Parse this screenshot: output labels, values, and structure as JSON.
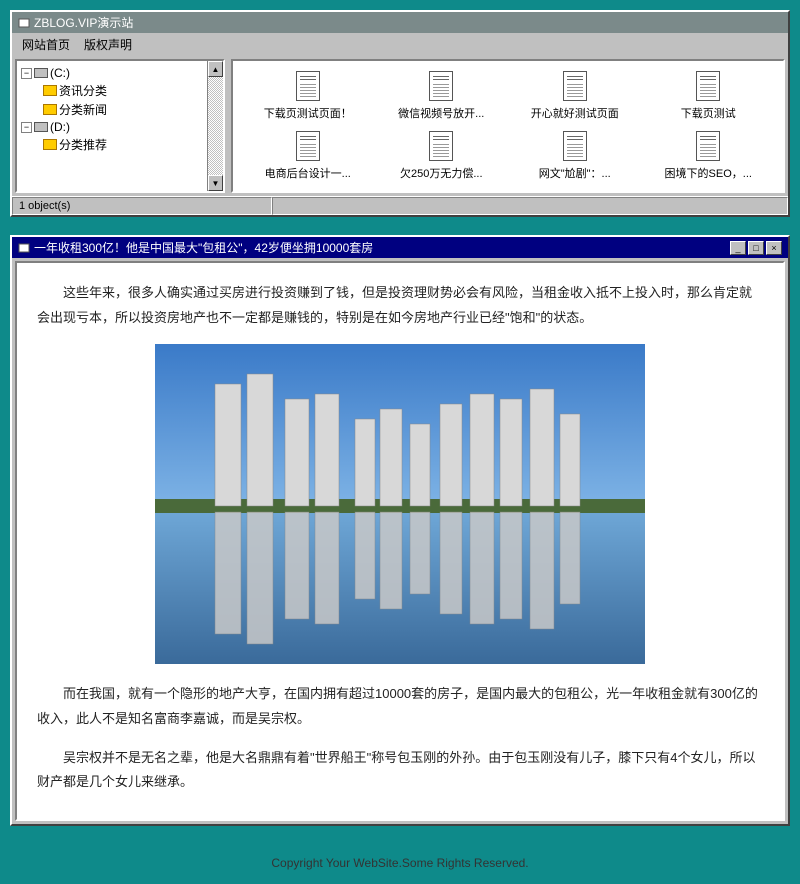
{
  "topWindow": {
    "title": "ZBLOG.VIP演示站",
    "menu": {
      "home": "网站首页",
      "copyright": "版权声明"
    },
    "tree": {
      "driveC": {
        "label": "(C:)",
        "children": [
          "资讯分类",
          "分类新闻"
        ]
      },
      "driveD": {
        "label": "(D:)",
        "children": [
          "分类推荐"
        ]
      }
    },
    "files": [
      "下载页测试页面！",
      "微信视频号放开...",
      "开心就好测试页面",
      "下载页测试",
      "电商后台设计一...",
      "欠250万无力偿...",
      "网文\"尬剧\"：...",
      "困境下的SEO，..."
    ],
    "status": "1 object(s)"
  },
  "article": {
    "title": "一年收租300亿！他是中国最大\"包租公\"，42岁便坐拥10000套房",
    "p1": "这些年来，很多人确实通过买房进行投资赚到了钱，但是投资理财势必会有风险，当租金收入抵不上投入时，那么肯定就会出现亏本，所以投资房地产也不一定都是赚钱的，特别是在如今房地产行业已经\"饱和\"的状态。",
    "p2": "而在我国，就有一个隐形的地产大亨，在国内拥有超过10000套的房子，是国内最大的包租公，光一年收租金就有300亿的收入，此人不是知名富商李嘉诚，而是吴宗权。",
    "p3": "吴宗权并不是无名之辈，他是大名鼎鼎有着\"世界船王\"称号包玉刚的外孙。由于包玉刚没有儿子，膝下只有4个女儿，所以财产都是几个女儿来继承。"
  },
  "footer": "Copyright Your WebSite.Some Rights Reserved.",
  "winbtns": {
    "min": "_",
    "max": "□",
    "close": "×"
  }
}
